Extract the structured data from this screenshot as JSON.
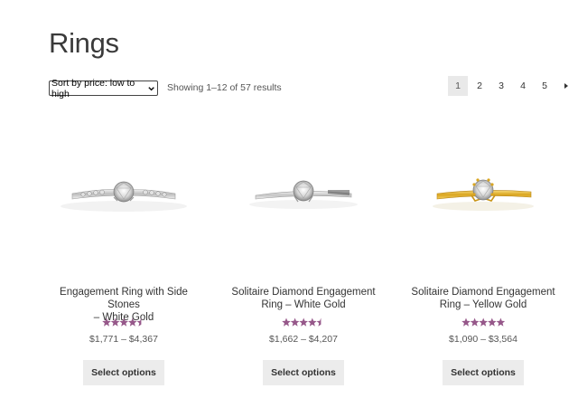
{
  "page": {
    "title": "Rings"
  },
  "toolbar": {
    "sort_value": "Sort by price: low to high",
    "result_count": "Showing 1–12 of 57 results"
  },
  "pagination": {
    "pages": [
      "1",
      "2",
      "3",
      "4",
      "5"
    ],
    "current": "1",
    "next_icon": "chevron-right-icon"
  },
  "products": [
    {
      "title_line1": "Engagement Ring with Side Stones",
      "title_line2": "– White Gold",
      "rating": 4.5,
      "price": "$1,771 – $4,367",
      "button": "Select options",
      "metal": "white-gold"
    },
    {
      "title_line1": "Solitaire Diamond Engagement",
      "title_line2": "Ring – White Gold",
      "rating": 4.5,
      "price": "$1,662 – $4,207",
      "button": "Select options",
      "metal": "white-gold"
    },
    {
      "title_line1": "Solitaire Diamond Engagement",
      "title_line2": "Ring – Yellow Gold",
      "rating": 5,
      "price": "$1,090 – $3,564",
      "button": "Select options",
      "metal": "yellow-gold"
    }
  ],
  "colors": {
    "star": "#96588a",
    "white_gold": "#d9d9d9",
    "yellow_gold": "#e0b52f",
    "button_bg": "#ececec",
    "current_page_bg": "#e9e9e9"
  }
}
